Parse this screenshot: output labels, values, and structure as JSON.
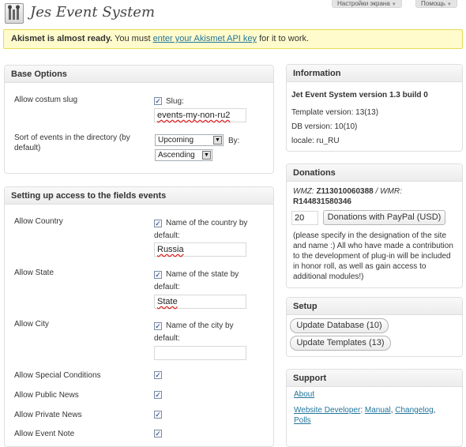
{
  "header": {
    "title": "Jes Event System",
    "screen_options": "Настройки экрана",
    "help": "Помощь"
  },
  "notice": {
    "strong": "Akismet is almost ready.",
    "text_before": " You must ",
    "link": "enter your Akismet API key",
    "text_after": " for it to work."
  },
  "base_options": {
    "title": "Base Options",
    "slug_label": "Allow costum slug",
    "slug_checkbox_label": "Slug:",
    "slug_value": "events-my-non-ru2",
    "sort_label": "Sort of events in the directory (by default)",
    "sort_select": "Upcoming",
    "by_label": "By:",
    "order_select": "Ascending"
  },
  "access": {
    "title": "Setting up access to the fields events",
    "rows": [
      {
        "label": "Allow Country",
        "checkbox_label": "Name of the country by default:",
        "value": "Russia"
      },
      {
        "label": "Allow State",
        "checkbox_label": "Name of the state by default:",
        "value": "State"
      },
      {
        "label": "Allow City",
        "checkbox_label": "Name of the city by default:",
        "value": ""
      },
      {
        "label": "Allow Special Conditions"
      },
      {
        "label": "Allow Public News"
      },
      {
        "label": "Allow Private News"
      },
      {
        "label": "Allow Event Note"
      }
    ]
  },
  "information": {
    "title": "Information",
    "version": "Jet Event System version 1.3 build 0",
    "template_version": "Template version: 13(13)",
    "db_version": "DB version: 10(10)",
    "locale": "locale: ru_RU"
  },
  "donations": {
    "title": "Donations",
    "wmz_label": "WMZ:",
    "wmz": "Z113010060388",
    "wmr_label": "/ WMR:",
    "wmr": "R144831580346",
    "amount": "20",
    "paypal_button": "Donations with PayPal (USD)",
    "note": "(please specify in the designation of the site and name :) All who have made a contribution to the development of plug-in will be included in honor roll, as well as gain access to additional modules!)"
  },
  "setup": {
    "title": "Setup",
    "update_db": "Update Database (10)",
    "update_templates": "Update Templates (13)"
  },
  "support": {
    "title": "Support",
    "about": "About",
    "website_developer": "Website Developer",
    "colon": ":",
    "manual": "Manual",
    "comma1": ",",
    "changelog": "Changelog",
    "comma2": ",",
    "polls": "Polls"
  }
}
